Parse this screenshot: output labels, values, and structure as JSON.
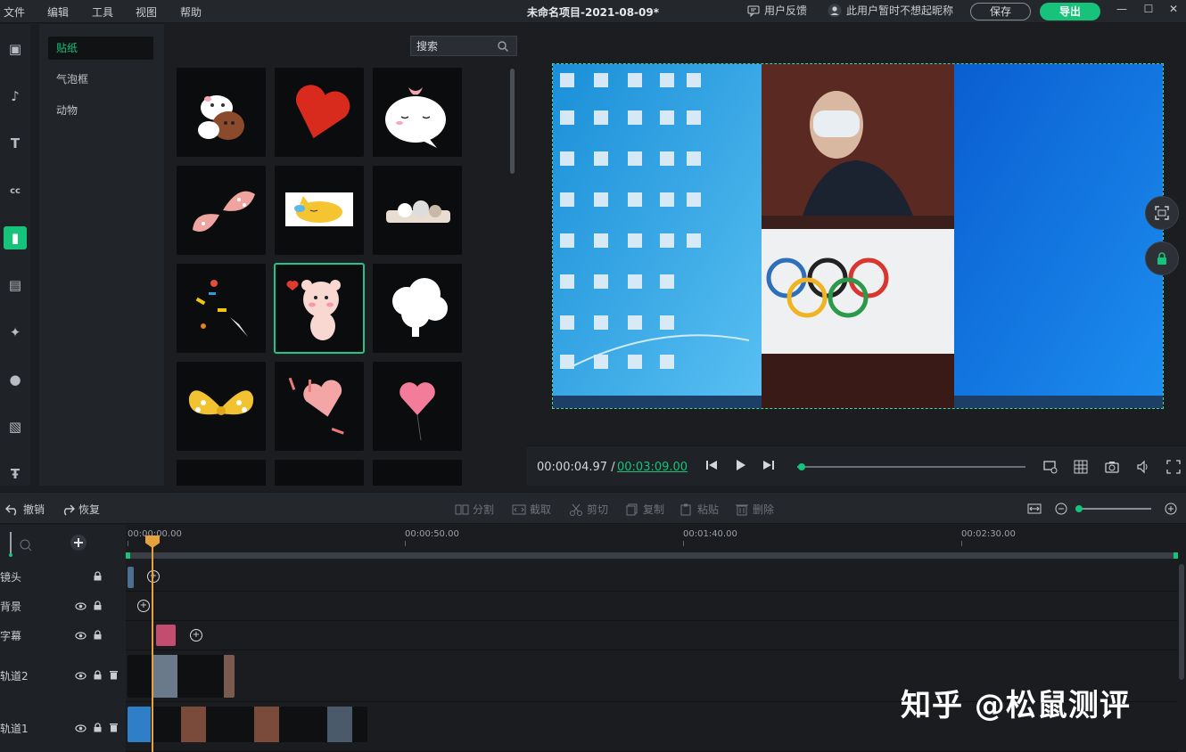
{
  "menu": {
    "file": "文件",
    "edit": "编辑",
    "tools": "工具",
    "view": "视图",
    "help": "帮助"
  },
  "project_title": "未命名项目-2021-08-09*",
  "header": {
    "feedback_label": "用户反馈",
    "user_label": "此用户暂时不想起昵称",
    "save_label": "保存",
    "export_label": "导出"
  },
  "window_controls": {
    "minimize": "—",
    "maximize": "☐",
    "close": "✕"
  },
  "rail": {
    "items": [
      {
        "icon": "media-icon",
        "glyph": "▣"
      },
      {
        "icon": "music-icon",
        "glyph": "♪"
      },
      {
        "icon": "text-icon",
        "glyph": "T"
      },
      {
        "icon": "caption-icon",
        "glyph": "cc"
      },
      {
        "icon": "sticker-icon",
        "glyph": "▮"
      },
      {
        "icon": "bubble-icon",
        "glyph": "▤"
      },
      {
        "icon": "effects-icon",
        "glyph": "✦"
      },
      {
        "icon": "person-icon",
        "glyph": "●"
      },
      {
        "icon": "filter-icon",
        "glyph": "▧"
      },
      {
        "icon": "title-template-icon",
        "glyph": "Ŧ"
      }
    ],
    "active_index": 4,
    "active_color": "#17c27a"
  },
  "categories": [
    {
      "label": "贴纸",
      "active": true
    },
    {
      "label": "气泡框",
      "active": false
    },
    {
      "label": "动物",
      "active": false
    }
  ],
  "library": {
    "search_placeholder": "搜索",
    "selected_index": 7,
    "stickers": [
      "cartoon-cats-sticker",
      "red-heart-sticker",
      "white-bun-sticker",
      "pink-butterfly-sticker",
      "sleepy-cat-sticker",
      "cats-peeking-sticker",
      "party-popper-sticker",
      "bear-heart-sticker",
      "white-cloud-sticker",
      "yellow-bow-sticker",
      "pink-heart-sticker",
      "heart-balloon-sticker"
    ]
  },
  "preview": {
    "time_current": "00:00:04.97 /",
    "time_total": "00:03:09.00",
    "progress": 0.02
  },
  "edit_toolbar": {
    "undo": "撤销",
    "redo": "恢复",
    "split": "分割",
    "crop": "截取",
    "cut": "剪切",
    "copy": "复制",
    "paste": "粘贴",
    "delete": "删除"
  },
  "timeline": {
    "ruler": [
      "00:00:00.00",
      "00:00:50.00",
      "00:01:40.00",
      "00:02:30.00"
    ],
    "tracks": [
      {
        "label": "镜头",
        "eye": false,
        "trash": false
      },
      {
        "label": "背景",
        "eye": true,
        "trash": false
      },
      {
        "label": "字幕",
        "eye": true,
        "trash": false
      },
      {
        "label": "轨道2",
        "eye": true,
        "trash": true
      },
      {
        "label": "轨道1",
        "eye": true,
        "trash": true
      }
    ]
  },
  "watermark": "知乎 @松鼠测评"
}
